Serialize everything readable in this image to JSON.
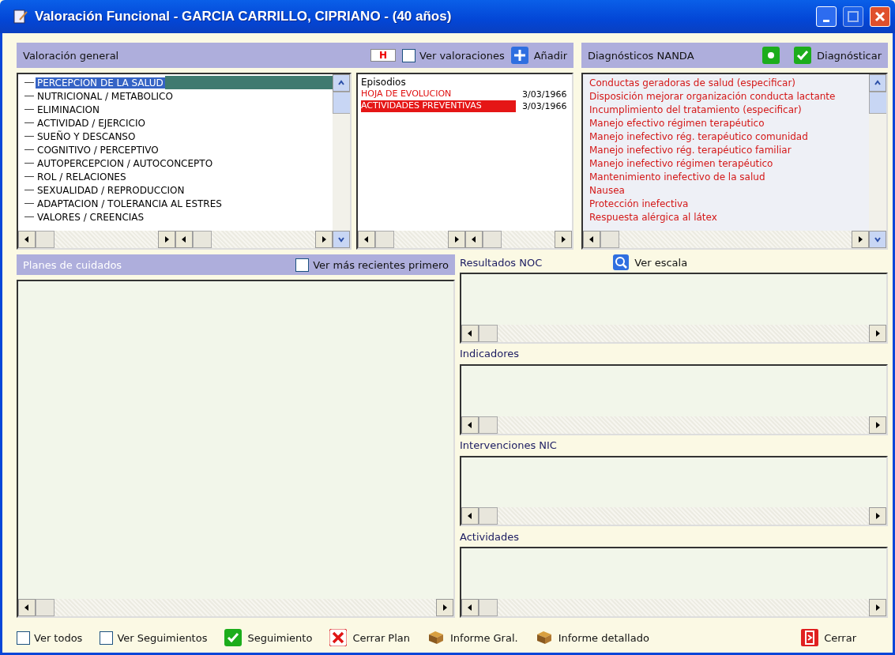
{
  "window": {
    "title": "Valoración Funcional - GARCIA CARRILLO, CIPRIANO - (40 años)"
  },
  "valoracion": {
    "label": "Valoración general",
    "h_badge": "H",
    "ver_valoraciones": {
      "label": "Ver valoraciones",
      "checked": false
    },
    "add_button": "Añadir",
    "tree": [
      {
        "label": "PERCEPCION DE LA SALUD",
        "selected": true
      },
      {
        "label": "NUTRICIONAL / METABOLICO",
        "selected": false
      },
      {
        "label": "ELIMINACION",
        "selected": false
      },
      {
        "label": "ACTIVIDAD / EJERCICIO",
        "selected": false
      },
      {
        "label": "SUEÑO Y DESCANSO",
        "selected": false
      },
      {
        "label": "COGNITIVO / PERCEPTIVO",
        "selected": false
      },
      {
        "label": "AUTOPERCEPCION / AUTOCONCEPTO",
        "selected": false
      },
      {
        "label": "ROL / RELACIONES",
        "selected": false
      },
      {
        "label": "SEXUALIDAD / REPRODUCCION",
        "selected": false
      },
      {
        "label": "ADAPTACION / TOLERANCIA AL ESTRES",
        "selected": false
      },
      {
        "label": "VALORES / CREENCIAS",
        "selected": false
      }
    ],
    "episodes": {
      "header": "Episodios",
      "rows": [
        {
          "name": "HOJA DE EVOLUCION",
          "date": "3/03/1966",
          "selected": false
        },
        {
          "name": "ACTIVIDADES PREVENTIVAS",
          "date": "3/03/1966",
          "selected": true
        }
      ]
    }
  },
  "diagnosticos": {
    "label": "Diagnósticos NANDA",
    "button": "Diagnósticar",
    "items": [
      "Conductas geradoras de salud (especificar)",
      "Disposición mejorar organización conducta lactante",
      "Incumplimiento del tratamiento (especificar)",
      "Manejo efectivo régimen terapéutico",
      "Manejo inefectivo rég. terapéutico comunidad",
      "Manejo inefectivo rég. terapéutico familiar",
      "Manejo inefectivo régimen terapéutico",
      "Mantenimiento inefectivo de la salud",
      "Nausea",
      "Protección inefectiva",
      "Respuesta alérgica al látex"
    ]
  },
  "planes": {
    "label": "Planes de cuidados",
    "recientes": {
      "label": "Ver más recientes primero",
      "checked": false
    }
  },
  "sections": [
    {
      "title": "Resultados NOC",
      "button": "Ver escala"
    },
    {
      "title": "Indicadores"
    },
    {
      "title": "Intervenciones NIC"
    },
    {
      "title": "Actividades"
    }
  ],
  "footer": {
    "checkboxes": [
      {
        "label": "Ver todos",
        "checked": false
      },
      {
        "label": "Ver Seguimientos",
        "checked": false
      }
    ],
    "buttons": [
      {
        "label": "Seguimiento",
        "kind": "check"
      },
      {
        "label": "Cerrar Plan",
        "kind": "cross"
      },
      {
        "label": "Informe Gral.",
        "kind": "report"
      },
      {
        "label": "Informe detallado",
        "kind": "report"
      },
      {
        "label": "Cerrar",
        "kind": "exit"
      }
    ]
  }
}
